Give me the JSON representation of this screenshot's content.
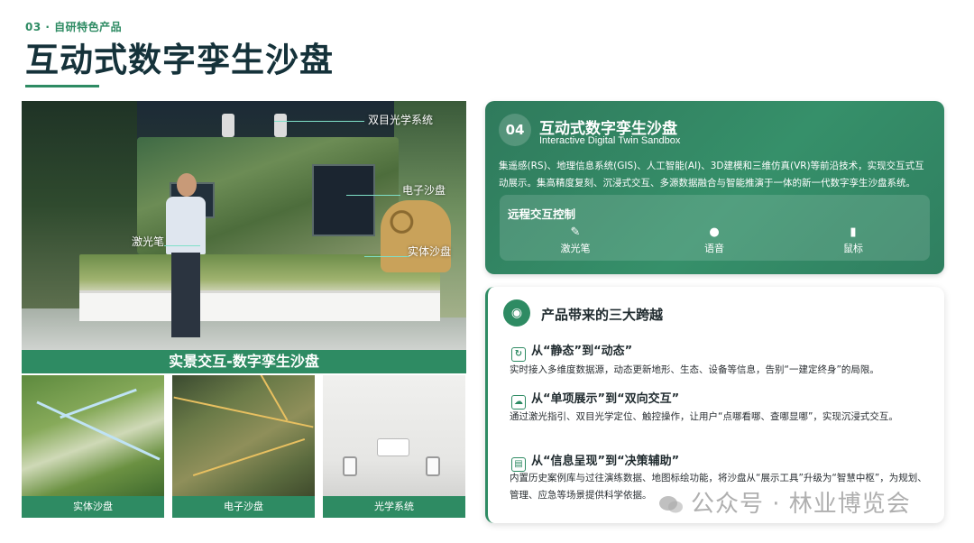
{
  "header": {
    "section_tag": "03 · 自研特色产品",
    "title": "互动式数字孪生沙盘"
  },
  "hero": {
    "callouts": {
      "binocular": "双目光学系统",
      "electronic": "电子沙盘",
      "laser": "激光笔",
      "physical": "实体沙盘"
    },
    "caption": "实景交互-数字孪生沙盘"
  },
  "thumbnails": [
    {
      "caption": "实体沙盘"
    },
    {
      "caption": "电子沙盘"
    },
    {
      "caption": "光学系统"
    }
  ],
  "product_card": {
    "number": "04",
    "title": "互动式数字孪生沙盘",
    "subtitle": "Interactive Digital Twin Sandbox",
    "description": "集遥感(RS)、地理信息系统(GIS)、人工智能(AI)、3D建模和三维仿真(VR)等前沿技术，实现交互式互动展示。集高精度复刻、沉浸式交互、多源数据融合与智能推演于一体的新一代数字孪生沙盘系统。",
    "remote": {
      "title": "远程交互控制",
      "items": [
        {
          "label": "激光笔",
          "icon": "laser-pen-icon"
        },
        {
          "label": "语音",
          "icon": "microphone-icon"
        },
        {
          "label": "鼠标",
          "icon": "mouse-icon"
        }
      ]
    }
  },
  "leap_card": {
    "title": "产品带来的三大跨越",
    "items": [
      {
        "heading": "从“静态”到“动态”",
        "text": "实时接入多维度数据源，动态更新地形、生态、设备等信息，告别“一建定终身”的局限。",
        "icon": "refresh-icon"
      },
      {
        "heading": "从“单项展示”到“双向交互”",
        "text": "通过激光指引、双目光学定位、触控操作，让用户“点哪看哪、查哪显哪”，实现沉浸式交互。",
        "icon": "cloud-icon"
      },
      {
        "heading": "从“信息呈现”到“决策辅助”",
        "text": "内置历史案例库与过往演练数据、地图标绘功能，将沙盘从“展示工具”升级为“智慧中枢”，为规划、管理、应急等场景提供科学依据。",
        "icon": "chart-icon"
      }
    ]
  },
  "watermark": "公众号 · 林业博览会",
  "colors": {
    "accent": "#2e8b63",
    "title": "#15323a"
  }
}
